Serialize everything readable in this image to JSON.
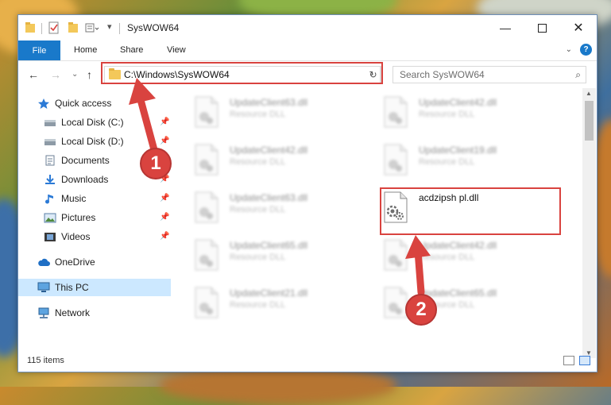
{
  "window": {
    "title": "SysWOW64"
  },
  "ribbon": {
    "tabs": [
      "File",
      "Home",
      "Share",
      "View"
    ],
    "help_label": "?"
  },
  "nav": {
    "address_path": "C:\\Windows\\SysWOW64",
    "search_placeholder": "Search SysWOW64"
  },
  "sidebar": {
    "items": [
      {
        "label": "Quick access",
        "icon": "star-icon"
      },
      {
        "label": "Local Disk (C:)",
        "icon": "drive-icon",
        "pinned": true
      },
      {
        "label": "Local Disk (D:)",
        "icon": "drive-icon",
        "pinned": true
      },
      {
        "label": "Documents",
        "icon": "documents-icon",
        "pinned": true
      },
      {
        "label": "Downloads",
        "icon": "downloads-icon",
        "pinned": true
      },
      {
        "label": "Music",
        "icon": "music-icon",
        "pinned": true
      },
      {
        "label": "Pictures",
        "icon": "pictures-icon",
        "pinned": true
      },
      {
        "label": "Videos",
        "icon": "videos-icon",
        "pinned": true
      },
      {
        "label": "OneDrive",
        "icon": "cloud-icon"
      },
      {
        "label": "This PC",
        "icon": "computer-icon",
        "selected": true
      },
      {
        "label": "Network",
        "icon": "network-icon"
      }
    ]
  },
  "files": [
    {
      "name": "UpdateClient63.dll",
      "type": "Resource DLL"
    },
    {
      "name": "UpdateClient42.dll",
      "type": "Resource DLL"
    },
    {
      "name": "UpdateClient42.dll",
      "type": "Resource DLL"
    },
    {
      "name": "UpdateClient19.dll",
      "type": "Resource DLL"
    },
    {
      "name": "UpdateClient63.dll",
      "type": "Resource DLL"
    },
    {
      "name": "acdzipsh pl.dll",
      "type": ""
    },
    {
      "name": "UpdateClient65.dll",
      "type": "Resource DLL"
    },
    {
      "name": "UpdateClient42.dll",
      "type": "Resource DLL"
    },
    {
      "name": "UpdateClient21.dll",
      "type": "Resource DLL"
    },
    {
      "name": "UpdateClient65.dll",
      "type": "Resource DLL"
    }
  ],
  "status": {
    "item_count": "115 items"
  },
  "annotations": {
    "step1": "1",
    "step2": "2",
    "color": "#d9433f"
  }
}
